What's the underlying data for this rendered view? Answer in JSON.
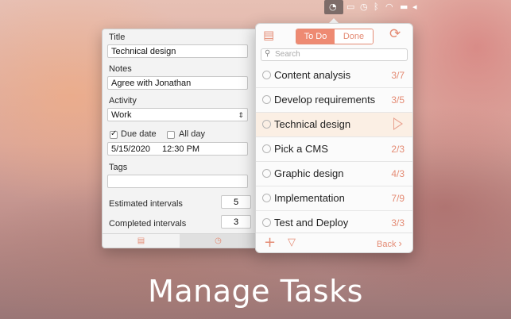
{
  "menubar": {
    "active_icon": "pomodoro-timer-icon",
    "status_icons": [
      "airplay-icon",
      "time-machine-icon",
      "bluetooth-icon",
      "wifi-icon",
      "flag-icon",
      "volume-icon"
    ]
  },
  "detail": {
    "title_label": "Title",
    "title_value": "Technical design",
    "notes_label": "Notes",
    "notes_value": "Agree with Jonathan",
    "activity_label": "Activity",
    "activity_value": "Work",
    "due_date_label": "Due date",
    "due_date_checked": true,
    "all_day_label": "All day",
    "all_day_checked": false,
    "date_value": "5/15/2020",
    "time_value": "12:30 PM",
    "tags_label": "Tags",
    "tags_value": "",
    "estimated_label": "Estimated intervals",
    "estimated_value": "5",
    "completed_label": "Completed intervals",
    "completed_value": "3",
    "tabs": [
      "notes-tab-icon",
      "clock-tab-icon"
    ]
  },
  "popover": {
    "segment": {
      "todo_label": "To Do",
      "done_label": "Done",
      "selected": "To Do"
    },
    "search_placeholder": "Search",
    "tasks": [
      {
        "name": "Content analysis",
        "count": "3/7"
      },
      {
        "name": "Develop requirements",
        "count": "3/5"
      },
      {
        "name": "Technical design",
        "count": "",
        "selected": true
      },
      {
        "name": "Pick a CMS",
        "count": "2/3"
      },
      {
        "name": "Graphic design",
        "count": "4/3"
      },
      {
        "name": "Implementation",
        "count": "7/9"
      },
      {
        "name": "Test and Deploy",
        "count": "3/3"
      }
    ],
    "back_label": "Back"
  },
  "colors": {
    "accent": "#ee8a72"
  },
  "headline": "Manage Tasks"
}
